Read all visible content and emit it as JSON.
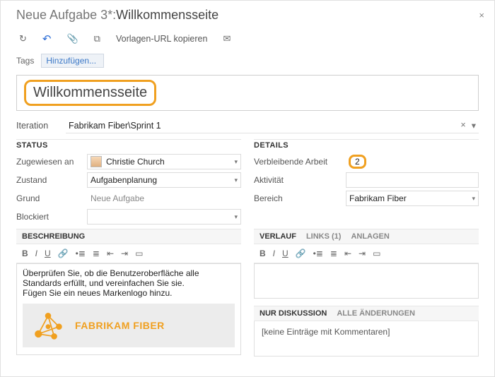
{
  "header": {
    "prefix": "Neue Aufgabe 3*: ",
    "title": "Willkommensseite",
    "close_glyph": "×"
  },
  "toolbar": {
    "refresh_glyph": "↻",
    "undo_glyph": "↶",
    "attach_glyph": "📎",
    "copy_glyph": "⧉",
    "copy_url_label": "Vorlagen-URL kopieren",
    "mail_glyph": "✉"
  },
  "tags": {
    "label": "Tags",
    "add_label": "Hinzufügen..."
  },
  "title_field": "Willkommensseite",
  "iteration": {
    "label": "Iteration",
    "value": "Fabrikam Fiber\\Sprint 1",
    "clear_glyph": "×",
    "dd_glyph": "▾"
  },
  "status": {
    "heading": "STATUS",
    "assigned_label": "Zugewiesen an",
    "assigned_value": "Christie Church",
    "state_label": "Zustand",
    "state_value": "Aufgabenplanung",
    "reason_label": "Grund",
    "reason_value": "Neue Aufgabe",
    "blocked_label": "Blockiert",
    "blocked_value": ""
  },
  "details": {
    "heading": "DETAILS",
    "remaining_label": "Verbleibende Arbeit",
    "remaining_value": "2",
    "activity_label": "Aktivität",
    "activity_value": "",
    "area_label": "Bereich",
    "area_value": "Fabrikam Fiber"
  },
  "description": {
    "heading": "BESCHREIBUNG",
    "text_line1": "Überprüfen Sie, ob die Benutzeroberfläche alle Standards erfüllt, und vereinfachen Sie sie.",
    "text_line2": "Fügen Sie ein neues Markenlogo hinzu.",
    "logo_text": "FABRIKAM FIBER"
  },
  "history": {
    "tab_history": "VERLAUF",
    "tab_links": "LINKS (1)",
    "tab_attachments": "ANLAGEN"
  },
  "discussion": {
    "tab_discussion": "NUR DISKUSSION",
    "tab_allchanges": "ALLE ÄNDERUNGEN",
    "empty_text": "[keine Einträge mit Kommentaren]"
  },
  "rt": {
    "bold": "B",
    "italic": "I",
    "underline": "U",
    "link": "🔗",
    "bullets": "•≣",
    "numbers": "≣",
    "outdent": "⇤",
    "indent": "⇥",
    "image": "▭"
  }
}
